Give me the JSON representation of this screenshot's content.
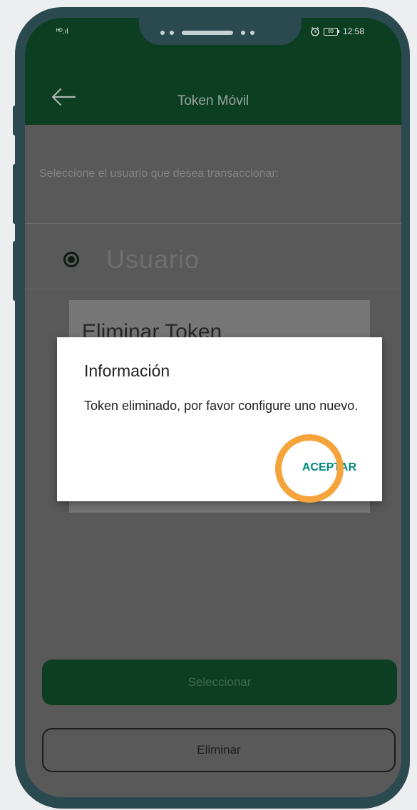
{
  "status_bar": {
    "signal_text": "ᴴᴰ.ıl",
    "time": "12:58",
    "battery_level": "89"
  },
  "header": {
    "title": "Token Móvil"
  },
  "content": {
    "prompt": "Seleccione el usuario que desea transaccionar:",
    "user_option": "Usuario",
    "behind_card_title": "Eliminar Token"
  },
  "dialog": {
    "title": "Información",
    "message": "Token eliminado, por favor configure uno nuevo.",
    "ok_label": "ACEPTAR"
  },
  "buttons": {
    "select_label": "Seleccionar",
    "delete_label": "Eliminar"
  },
  "colors": {
    "header_green": "#0c3e22",
    "accent_teal": "#00897b",
    "highlight_orange": "#f5a33a",
    "phone_frame": "#2b4a4f"
  }
}
